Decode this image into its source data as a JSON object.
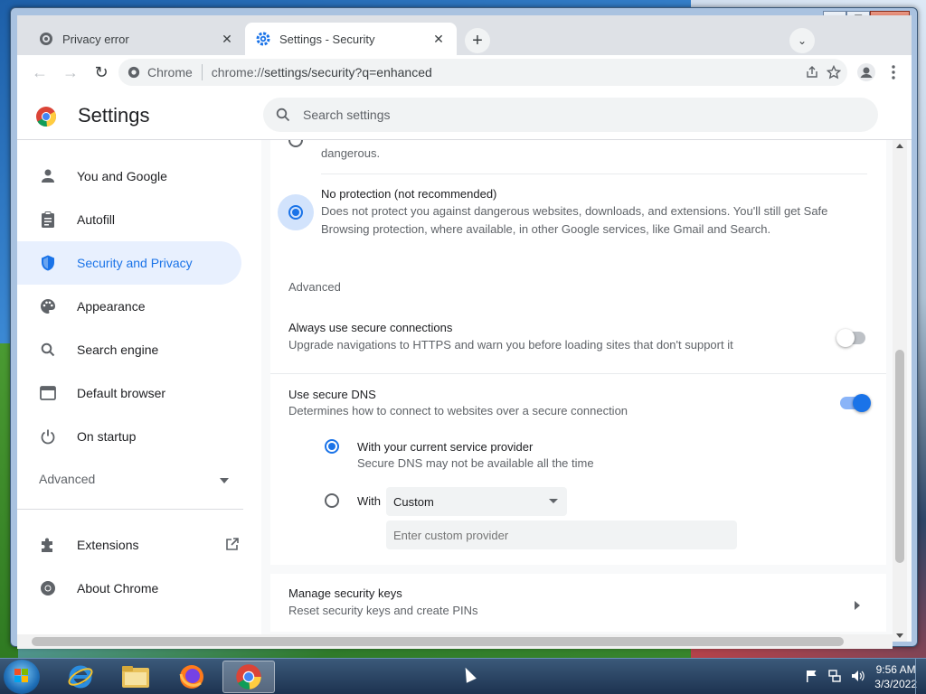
{
  "window": {
    "min": "▁",
    "max": "❐",
    "close": "✕"
  },
  "tabs": [
    {
      "label": "Privacy error",
      "close": "✕"
    },
    {
      "label": "Settings - Security",
      "close": "✕"
    }
  ],
  "newtab": "+",
  "tabsearch": "⌄",
  "toolbar": {
    "back": "←",
    "forward": "→",
    "reload": "↻",
    "site": "Chrome",
    "url_scheme": "chrome://",
    "url_rest": "settings/security?q=enhanced"
  },
  "header": {
    "title": "Settings",
    "search_placeholder": "Search settings"
  },
  "sidebar": {
    "items": [
      {
        "label": "You and Google",
        "icon": "person-icon"
      },
      {
        "label": "Autofill",
        "icon": "clipboard-icon"
      },
      {
        "label": "Security and Privacy",
        "icon": "shield-icon"
      },
      {
        "label": "Appearance",
        "icon": "palette-icon"
      },
      {
        "label": "Search engine",
        "icon": "search-icon"
      },
      {
        "label": "Default browser",
        "icon": "browser-icon"
      },
      {
        "label": "On startup",
        "icon": "power-icon"
      }
    ],
    "advanced": "Advanced",
    "extensions": "Extensions",
    "about": "About Chrome"
  },
  "content": {
    "prev_text": "dangerous.",
    "no_protection_title": "No protection (not recommended)",
    "no_protection_desc_1": "Does not protect you against dangerous websites, downloads, and extensions. You'll still get Safe",
    "no_protection_desc_2": "Browsing protection, where available, in other Google services, like Gmail and Search.",
    "advanced_heading": "Advanced",
    "https_title": "Always use secure connections",
    "https_desc": "Upgrade navigations to HTTPS and warn you before loading sites that don't support it",
    "https_enabled": false,
    "dns_title": "Use secure DNS",
    "dns_desc": "Determines how to connect to websites over a secure connection",
    "dns_enabled": true,
    "dns_current_title": "With your current service provider",
    "dns_current_desc": "Secure DNS may not be available all the time",
    "dns_with": "With",
    "dns_select": "Custom",
    "dns_custom_placeholder": "Enter custom provider",
    "keys_title": "Manage security keys",
    "keys_desc": "Reset security keys and create PINs"
  },
  "taskbar": {
    "time": "9:56 AM",
    "date": "3/3/2022"
  },
  "colors": {
    "accent": "#1a73e8",
    "selected_bg": "#e8f0fe"
  }
}
